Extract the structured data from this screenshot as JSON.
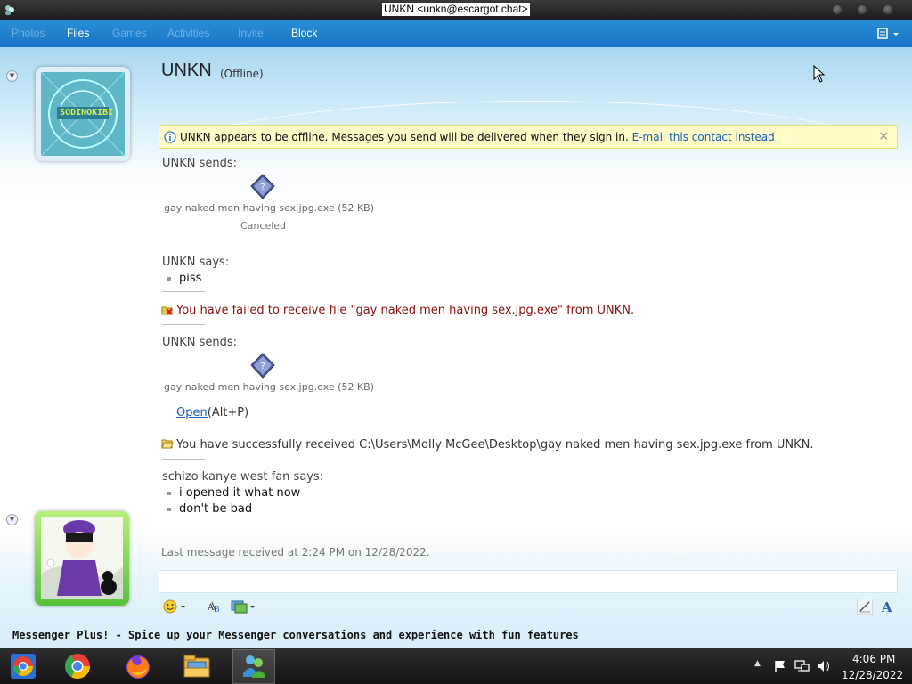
{
  "window": {
    "title": "UNKN <unkn@escargot.chat>"
  },
  "menu": {
    "items": [
      {
        "label": "Photos",
        "enabled": false
      },
      {
        "label": "Files",
        "enabled": true
      },
      {
        "label": "Games",
        "enabled": false
      },
      {
        "label": "Activities",
        "enabled": false
      },
      {
        "label": "Invite",
        "enabled": false
      },
      {
        "label": "Block",
        "enabled": true
      }
    ]
  },
  "contact": {
    "name": "UNKN",
    "status": "(Offline)",
    "avatar_text": "SODINOKIBI"
  },
  "info_bar": {
    "message": "UNKN appears to be offline. Messages you send will be delivered when they sign in.",
    "link": "E-mail this contact instead",
    "close": "×"
  },
  "conversation": {
    "transfer1": {
      "sender": "UNKN sends:",
      "filename": "gay naked men having sex.jpg.exe (52 KB)",
      "status": "Canceled"
    },
    "message1": {
      "sender": "UNKN says:",
      "lines": [
        "piss"
      ]
    },
    "failed_notice": "You have failed to receive file \"gay naked men having sex.jpg.exe\" from UNKN.",
    "transfer2": {
      "sender": "UNKN sends:",
      "filename": "gay naked men having sex.jpg.exe (52 KB)",
      "open_link": "Open",
      "open_shortcut": "(Alt+P)"
    },
    "success_notice": "You have successfully received C:\\Users\\Molly McGee\\Desktop\\gay naked men having sex.jpg.exe from UNKN.",
    "message2": {
      "sender": "schizo kanye west fan says:",
      "lines": [
        "i opened it what now",
        "don't be bad"
      ]
    },
    "last_message": "Last message received at 2:24 PM on 12/28/2022."
  },
  "promo": "Messenger Plus! - Spice up your Messenger conversations and experience with fun features",
  "taskbar": {
    "apps": [
      "chrome-os-icon",
      "chrome-icon",
      "firefox-icon",
      "file-explorer-icon",
      "messenger-icon"
    ],
    "time": "4:06 PM",
    "date": "12/28/2022"
  },
  "colors": {
    "menubar": "#1b7fcc",
    "link": "#1a5fb6",
    "error": "#8b1010",
    "info_bg": "#fefbc7"
  }
}
